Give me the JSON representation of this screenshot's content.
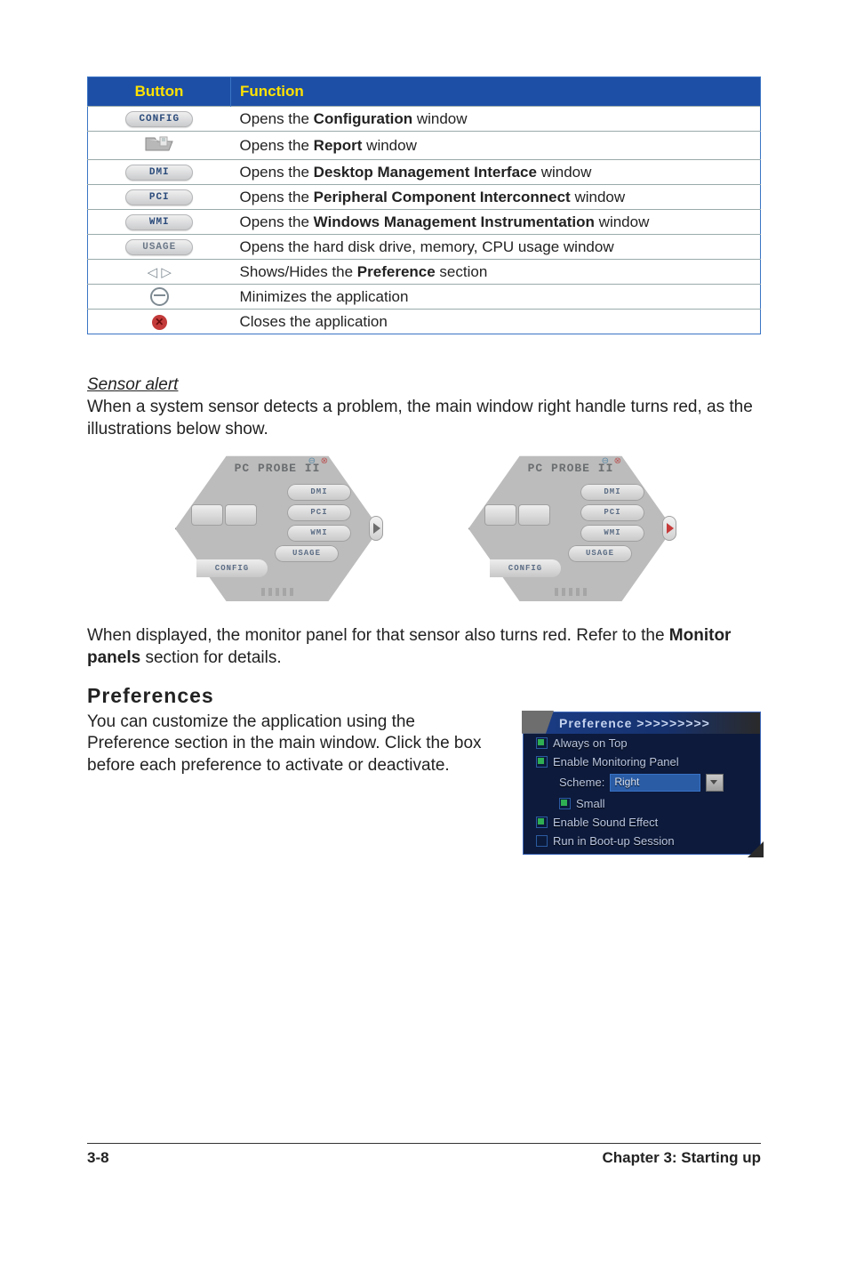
{
  "table": {
    "headers": {
      "button": "Button",
      "function": "Function"
    },
    "rows": [
      {
        "btn_label": "CONFIG",
        "pre": "Opens the ",
        "bold": "Configuration",
        "post": " window"
      },
      {
        "btn_label": "",
        "pre": "Opens the ",
        "bold": "Report",
        "post": " window"
      },
      {
        "btn_label": "DMI",
        "pre": "Opens the ",
        "bold": "Desktop Management Interface",
        "post": " window"
      },
      {
        "btn_label": "PCI",
        "pre": "Opens the ",
        "bold": "Peripheral Component Interconnect",
        "post": " window"
      },
      {
        "btn_label": "WMI",
        "pre": "Opens the ",
        "bold": "Windows Management Instrumentation",
        "post": " window"
      },
      {
        "btn_label": "USAGE",
        "pre": "Opens the hard disk drive, memory, CPU usage window",
        "bold": "",
        "post": ""
      },
      {
        "btn_label": "",
        "pre": "Shows/Hides the ",
        "bold": "Preference",
        "post": " section"
      },
      {
        "btn_label": "",
        "pre": "Minimizes the application",
        "bold": "",
        "post": ""
      },
      {
        "btn_label": "",
        "pre": "Closes the application",
        "bold": "",
        "post": ""
      }
    ]
  },
  "sensor_alert": {
    "heading": "Sensor alert",
    "p1": "When a system sensor detects a problem, the main window right handle turns red, as the illustrations below show.",
    "p2_pre": "When displayed, the monitor panel for that sensor also turns red. Refer to the ",
    "p2_bold": "Monitor panels",
    "p2_post": " section for details."
  },
  "probe": {
    "title": "PC PROBE II",
    "dmi": "DMI",
    "pci": "PCI",
    "wmi": "WMI",
    "usage": "USAGE",
    "config": "CONFIG"
  },
  "preferences": {
    "heading": "Preferences",
    "para": "You can customize the application using the Preference section in the main window. Click the box before each preference to activate or deactivate.",
    "panel": {
      "header": "Preference >>>>>>>>>",
      "always_on_top": "Always on Top",
      "enable_monitoring": "Enable Monitoring Panel",
      "scheme_label": "Scheme:",
      "scheme_value": "Right",
      "small": "Small",
      "enable_sound": "Enable Sound Effect",
      "run_boot": "Run in Boot-up Session"
    }
  },
  "footer": {
    "page": "3-8",
    "chapter": "Chapter 3: Starting up"
  }
}
